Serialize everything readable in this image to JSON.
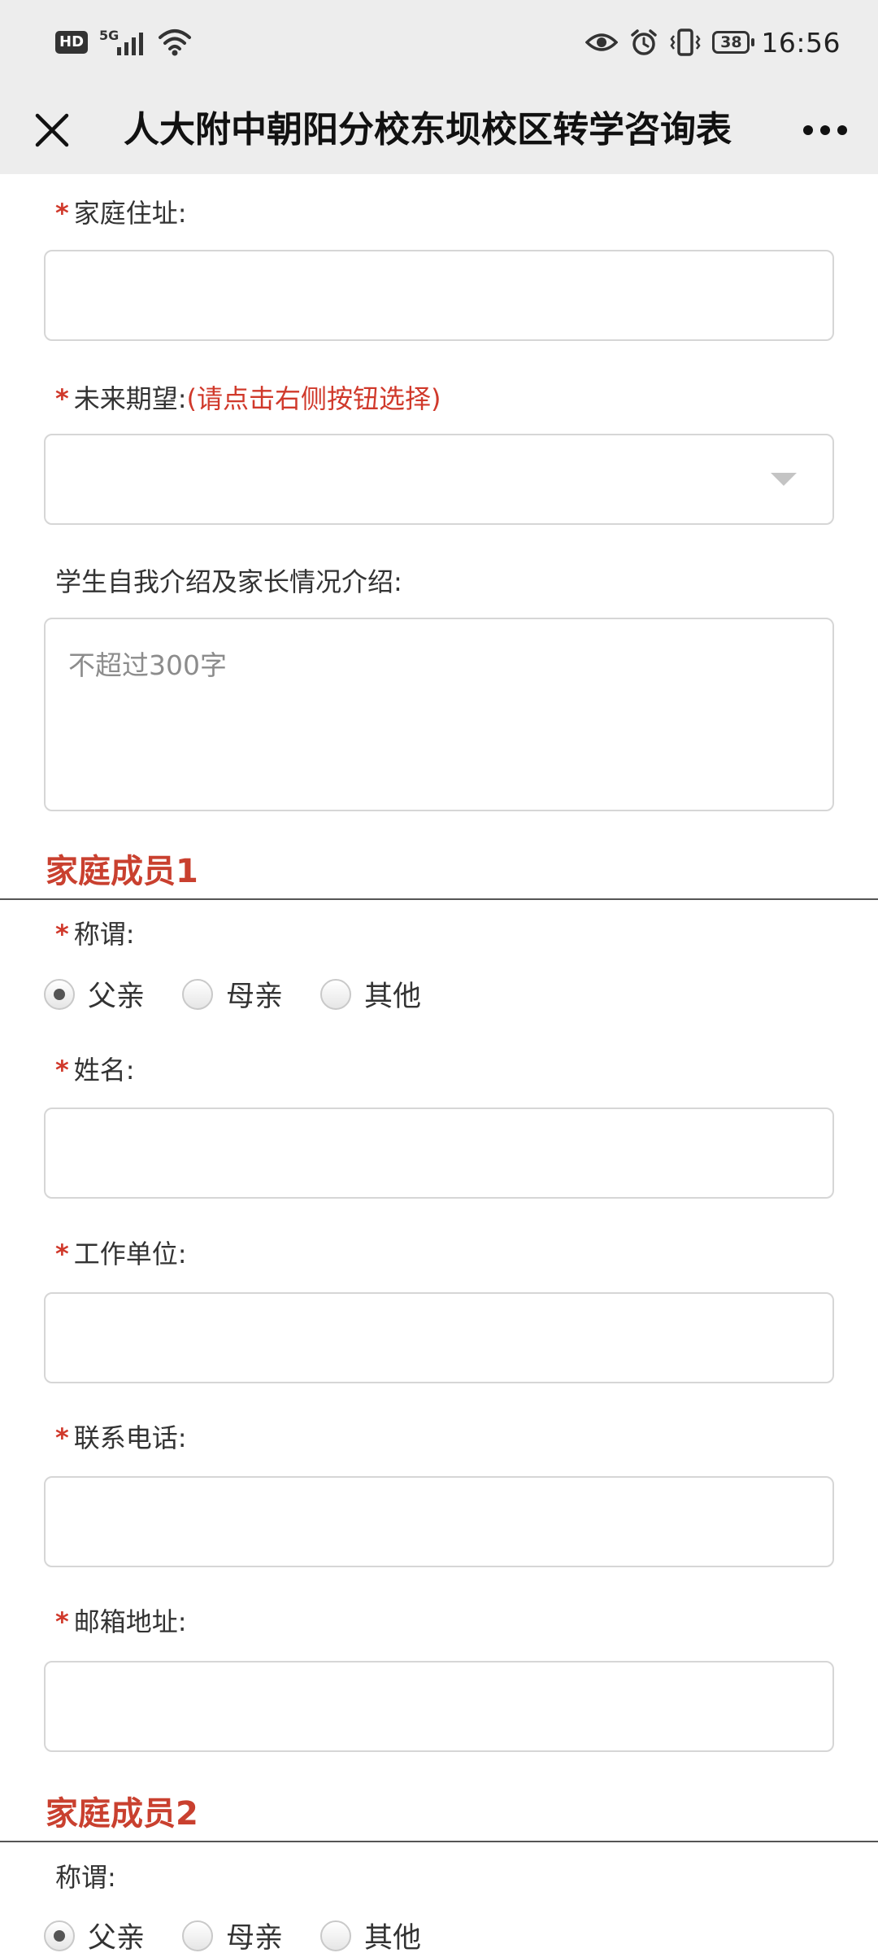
{
  "status_bar": {
    "hd_badge": "HD",
    "network_label": "5G",
    "battery_level": "38",
    "time": "16:56",
    "icons": [
      "signal-icon",
      "wifi-icon",
      "eye-icon",
      "alarm-icon",
      "vibrate-icon",
      "battery-icon"
    ]
  },
  "nav": {
    "title": "人大附中朝阳分校东坝校区转学咨询表",
    "close_icon": "close-icon",
    "more_icon": "more-icon"
  },
  "form": {
    "required_mark": "*",
    "home_address": {
      "label": "家庭住址:",
      "value": ""
    },
    "future_expectation": {
      "label": "未来期望:",
      "hint": "(请点击右侧按钮选择)",
      "selected": ""
    },
    "introduction": {
      "label": "学生自我介绍及家长情况介绍:",
      "placeholder": "不超过300字"
    }
  },
  "family_member_1": {
    "section_title": "家庭成员1",
    "relation": {
      "label": "称谓:",
      "options": [
        "父亲",
        "母亲",
        "其他"
      ],
      "selected": "父亲"
    },
    "name": {
      "label": "姓名:",
      "value": ""
    },
    "employer": {
      "label": "工作单位:",
      "value": ""
    },
    "phone": {
      "label": "联系电话:",
      "value": ""
    },
    "email": {
      "label": "邮箱地址:",
      "value": ""
    }
  },
  "family_member_2": {
    "section_title": "家庭成员2",
    "relation": {
      "label": "称谓:",
      "options": [
        "父亲",
        "母亲",
        "其他"
      ],
      "selected": "父亲"
    }
  },
  "colors": {
    "accent_red": "#c9402f",
    "bar_background": "#ededed",
    "border": "#d6d6d6"
  }
}
